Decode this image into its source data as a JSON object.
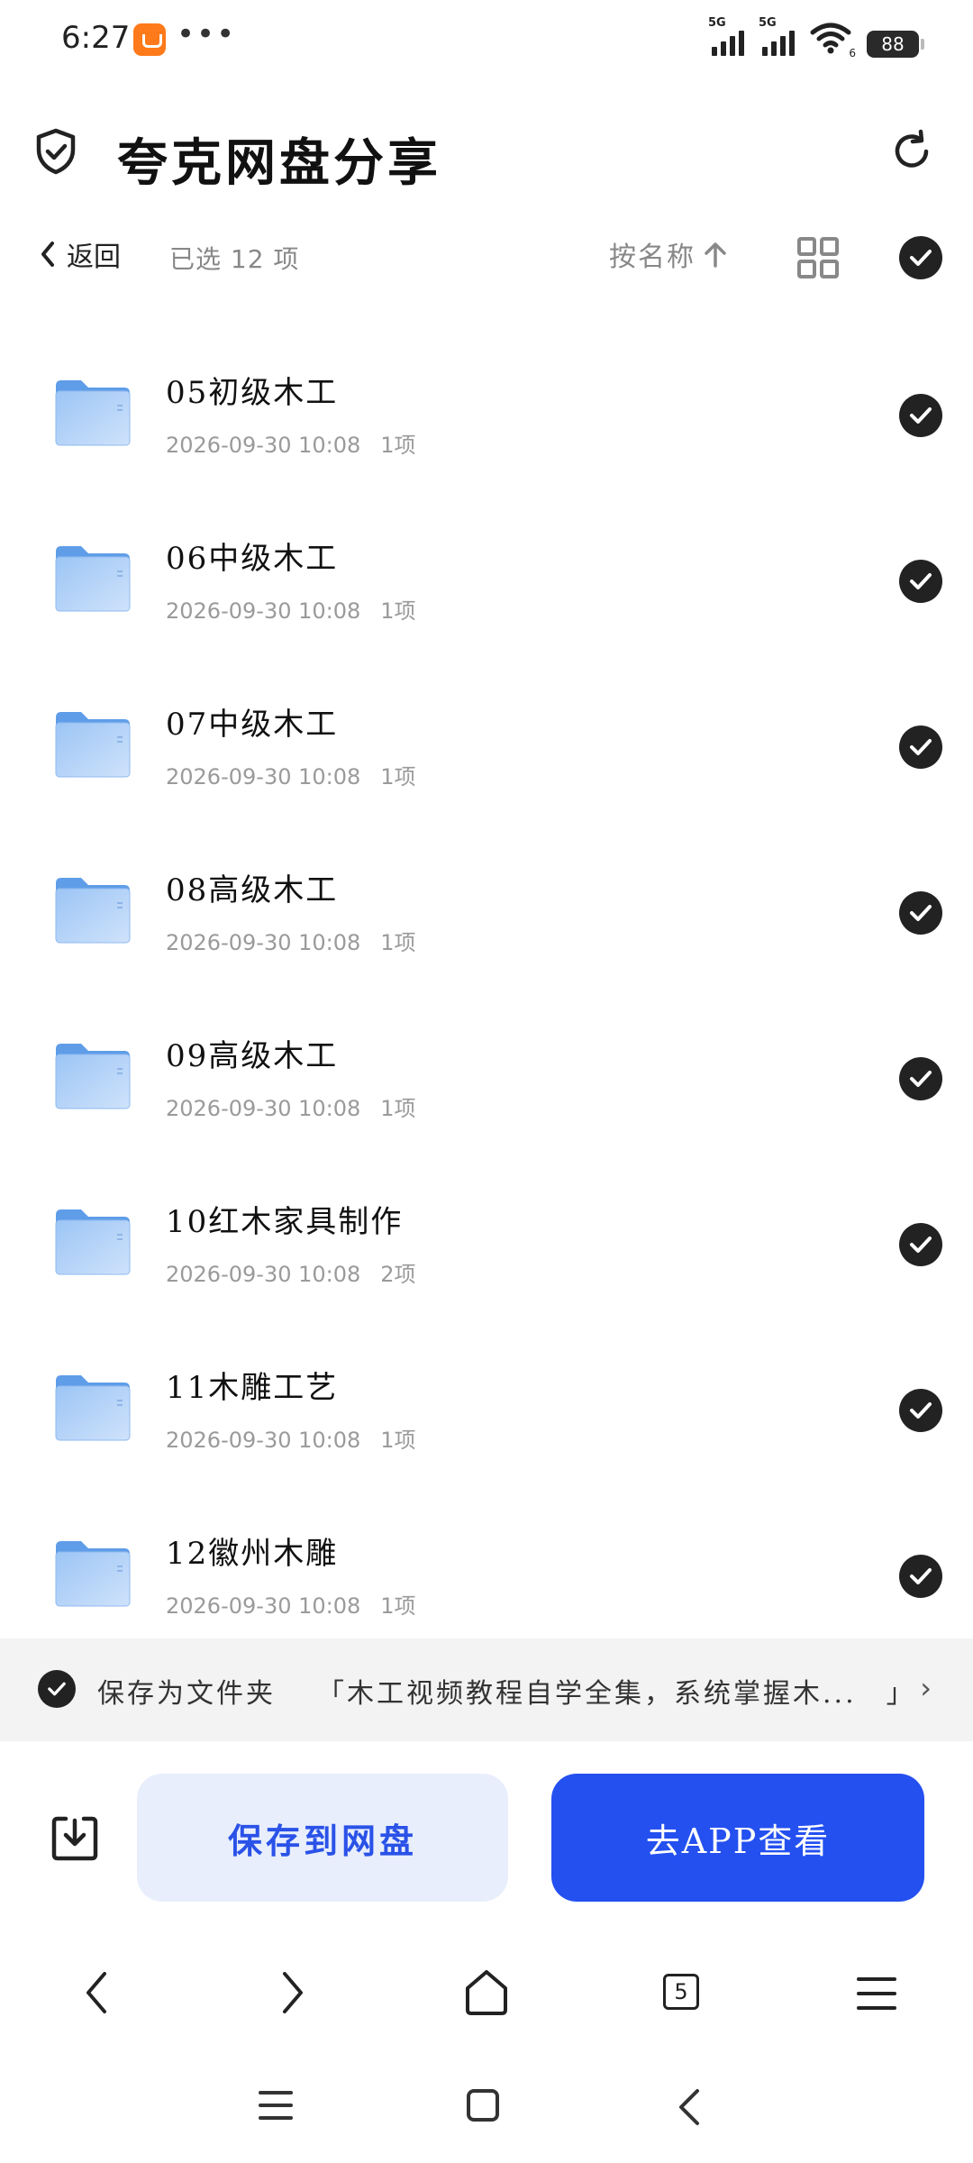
{
  "status_bar": {
    "time": "6:27",
    "network_1": "5G",
    "network_2": "5G",
    "wifi_badge": "6",
    "battery": "88"
  },
  "header": {
    "title": "夸克网盘分享"
  },
  "toolbar": {
    "back_label": "返回",
    "selected_label": "已选 12 项",
    "sort_label": "按名称"
  },
  "files": [
    {
      "name": "05初级木工",
      "date": "2026-09-30 10:08",
      "count": "1项"
    },
    {
      "name": "06中级木工",
      "date": "2026-09-30 10:08",
      "count": "1项"
    },
    {
      "name": "07中级木工",
      "date": "2026-09-30 10:08",
      "count": "1项"
    },
    {
      "name": "08高级木工",
      "date": "2026-09-30 10:08",
      "count": "1项"
    },
    {
      "name": "09高级木工",
      "date": "2026-09-30 10:08",
      "count": "1项"
    },
    {
      "name": "10红木家具制作",
      "date": "2026-09-30 10:08",
      "count": "2项"
    },
    {
      "name": "11木雕工艺",
      "date": "2026-09-30 10:08",
      "count": "1项"
    },
    {
      "name": "12徽州木雕",
      "date": "2026-09-30 10:08",
      "count": "1项"
    }
  ],
  "save_bar": {
    "label": "保存为文件夹",
    "folder_name": "「木工视频教程自学全集，系统掌握木...　」"
  },
  "actions": {
    "save_button": "保存到网盘",
    "app_button": "去APP查看"
  },
  "browser_nav": {
    "tab_count": "5"
  },
  "colors": {
    "primary_blue": "#2450f0",
    "light_blue_button": "#e8eefc",
    "folder_blue": "#7fb3f0",
    "check_dark": "#222222"
  }
}
